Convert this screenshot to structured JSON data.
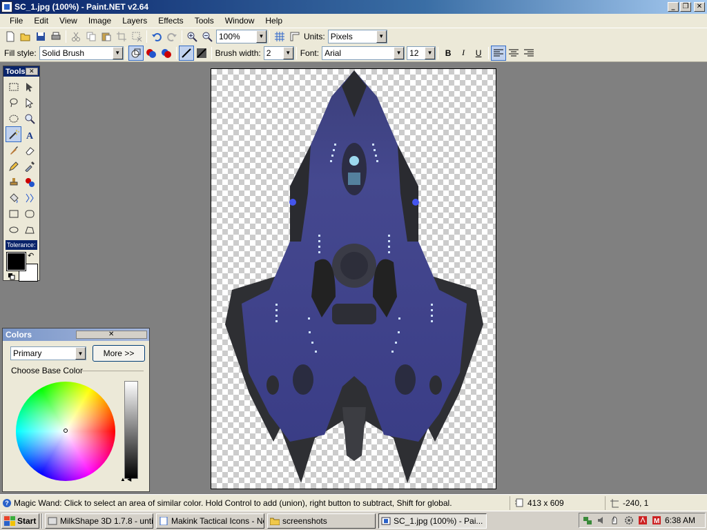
{
  "window": {
    "title": "SC_1.jpg (100%) - Paint.NET v2.64",
    "minimize": "_",
    "maximize": "❐",
    "close": "✕"
  },
  "menu": [
    "File",
    "Edit",
    "View",
    "Image",
    "Layers",
    "Effects",
    "Tools",
    "Window",
    "Help"
  ],
  "toolbar": {
    "zoom_value": "100%",
    "units_label": "Units:",
    "units_value": "Pixels"
  },
  "tool_options": {
    "fill_style_label": "Fill style:",
    "fill_style_value": "Solid Brush",
    "brush_width_label": "Brush width:",
    "brush_width_value": "2",
    "font_label": "Font:",
    "font_value": "Arial",
    "font_size_value": "12",
    "bold": "B",
    "italic": "I",
    "underline": "U"
  },
  "tools_window": {
    "title": "Tools",
    "close": "✕",
    "tolerance_label": "Tolerance:",
    "selected_tool": "magic-wand"
  },
  "colors_window": {
    "title": "Colors",
    "close": "✕",
    "palette_select": "Primary",
    "more_button": "More >>",
    "base_color_label": "Choose Base Color",
    "primary_color": "#000000",
    "secondary_color": "#ffffff"
  },
  "status": {
    "help_text": "Magic Wand: Click to select an area of similar color. Hold Control to add (union), right button to subtract, Shift for global.",
    "image_size": "413 x 609",
    "cursor_position": "-240, 1"
  },
  "taskbar": {
    "start_label": "Start",
    "tasks": [
      "MilkShape 3D 1.7.8 - untit...",
      "Makink Tactical Icons - No...",
      "screenshots",
      "SC_1.jpg (100%) - Pai..."
    ],
    "active_task_index": 3,
    "clock": "6:38 AM"
  }
}
